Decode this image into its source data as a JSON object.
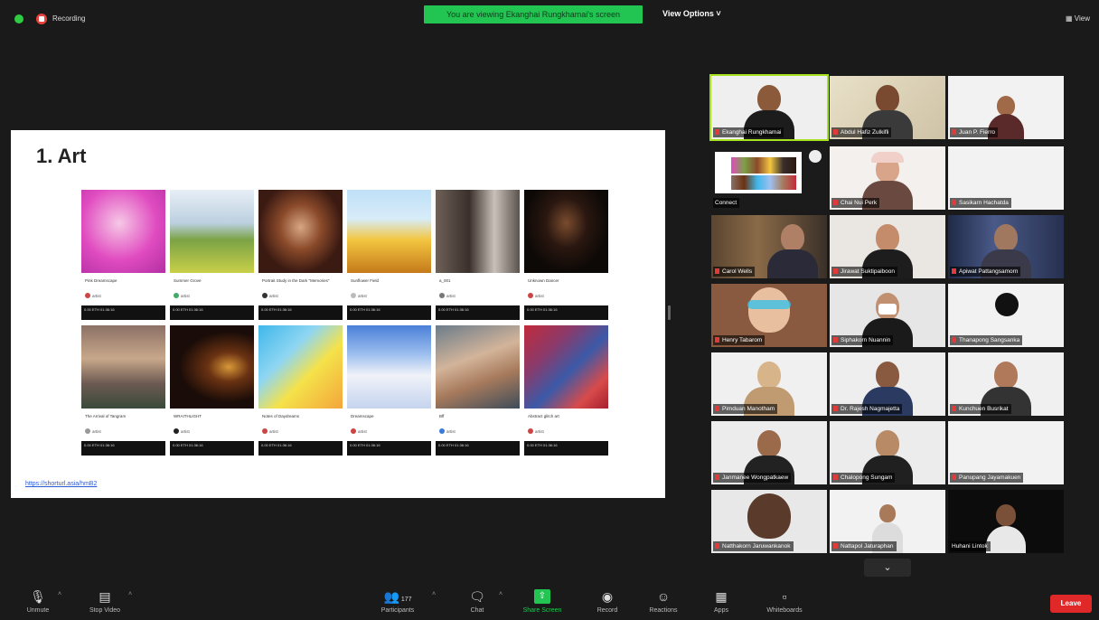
{
  "top": {
    "recording_label": "Recording",
    "share_banner": "You are viewing Ekanghai Rungkhamai's screen",
    "view_options": "View Options ˅",
    "view_toggle": "▦ View"
  },
  "slide": {
    "title": "1. Art",
    "link": "https://shorturl.asia/hmB2",
    "cards": [
      {
        "title": "Pink Dreamscape",
        "artist": "artist",
        "bar": "0.00 ETH    01:36:16"
      },
      {
        "title": "Summer Grove",
        "artist": "artist",
        "bar": "0.00 ETH    01:36:16"
      },
      {
        "title": "Portrait Study in the Dark \"Memories\"",
        "artist": "artist",
        "bar": "0.00 ETH    01:36:16"
      },
      {
        "title": "Sunflower Field",
        "artist": "artist",
        "bar": "0.00 ETH    01:36:16"
      },
      {
        "title": "a_001",
        "artist": "artist",
        "bar": "0.00 ETH    01:36:16"
      },
      {
        "title": "Unknown Dancer",
        "artist": "artist",
        "bar": "0.00 ETH    01:36:16"
      },
      {
        "title": "The Arrival of Tangram",
        "artist": "artist",
        "bar": "0.00 ETH    01:36:16"
      },
      {
        "title": "WRAITHLIGHT",
        "artist": "artist",
        "bar": "0.00 ETH    01:36:16"
      },
      {
        "title": "Notes of Daydreams",
        "artist": "artist",
        "bar": "0.00 ETH    01:36:16"
      },
      {
        "title": "Dreamscape",
        "artist": "artist",
        "bar": "0.00 ETH    01:36:16"
      },
      {
        "title": "Bff",
        "artist": "artist",
        "bar": "0.00 ETH    01:36:16"
      },
      {
        "title": "Abstract glitch art",
        "artist": "artist",
        "bar": "0.00 ETH    01:36:16"
      }
    ]
  },
  "participants": [
    {
      "name": "Ekanghai Rungkhamai"
    },
    {
      "name": "Abdul Hafiz Zulkifli"
    },
    {
      "name": "Juan P. Fierro"
    },
    {
      "name": "Connect"
    },
    {
      "name": "Chai Nui Perk"
    },
    {
      "name": "Sasikarn Hachatda"
    },
    {
      "name": "Carol Wells"
    },
    {
      "name": "Jirawat Suktipaiboon"
    },
    {
      "name": "Apiwat Pattangsamorn"
    },
    {
      "name": "Henry Tabarom"
    },
    {
      "name": "Siphakorn Nuannin"
    },
    {
      "name": "Thanapong Sangsanka"
    },
    {
      "name": "Pimduan Manotham"
    },
    {
      "name": "Dr. Rajesh Nagmajetta"
    },
    {
      "name": "Kunchuen Busrikat"
    },
    {
      "name": "Janmanee Wongpatkaew"
    },
    {
      "name": "Chalopong Sungam"
    },
    {
      "name": "Panupang Jayamakuen"
    },
    {
      "name": "Natthakorn Jaruwankanok"
    },
    {
      "name": "Nattapol Jaturaphan"
    },
    {
      "name": "Huhani Lintok"
    }
  ],
  "toolbar": {
    "unmute": "Unmute",
    "stop_video": "Stop Video",
    "participants": "Participants",
    "participants_count": "177",
    "chat": "Chat",
    "share_screen": "Share Screen",
    "record": "Record",
    "reactions": "Reactions",
    "apps": "Apps",
    "whiteboards": "Whiteboards",
    "leave": "Leave"
  }
}
